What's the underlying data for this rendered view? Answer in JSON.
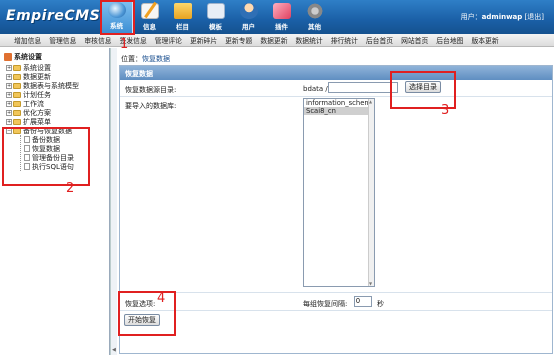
{
  "header": {
    "logo": "EmpireCMS",
    "nav": [
      {
        "label": "系统",
        "icon": "globe-icon",
        "active": true
      },
      {
        "label": "信息",
        "icon": "pencil-icon",
        "active": false
      },
      {
        "label": "栏目",
        "icon": "folder-icon",
        "active": false
      },
      {
        "label": "模板",
        "icon": "template-icon",
        "active": false
      },
      {
        "label": "用户",
        "icon": "user-icon",
        "active": false
      },
      {
        "label": "插件",
        "icon": "plugin-icon",
        "active": false
      },
      {
        "label": "其他",
        "icon": "gear-icon",
        "active": false
      }
    ],
    "user_prefix": "用户：",
    "username": "adminwap",
    "logout": "[退出]"
  },
  "menubar": [
    "增加信息",
    "管理信息",
    "审核信息",
    "签发信息",
    "管理评论",
    "更新碎片",
    "更新专题",
    "数据更新",
    "数据统计",
    "排行统计",
    "后台首页",
    "网站首页",
    "后台地图",
    "版本更新"
  ],
  "sidebar": {
    "root": "系统设置",
    "items": [
      {
        "label": "系统设置"
      },
      {
        "label": "数据更新"
      },
      {
        "label": "数据表与系统模型"
      },
      {
        "label": "计划任务"
      },
      {
        "label": "工作流"
      },
      {
        "label": "优化方案"
      },
      {
        "label": "扩展菜单"
      }
    ],
    "open_item": "备份与恢复数据",
    "sub_items": [
      {
        "label": "备份数据"
      },
      {
        "label": "恢复数据"
      },
      {
        "label": "管理备份目录"
      },
      {
        "label": "执行SQL语句"
      }
    ]
  },
  "main": {
    "location_prefix": "位置：",
    "location_link": "恢复数据",
    "panel_title": "恢复数据",
    "path_label": "恢复数据源目录:",
    "path_prefix": "bdata /",
    "path_value": "",
    "choose_dir_button": "选择目录",
    "db_label": "要导入的数据库:",
    "db_options": [
      "information_schema",
      "Scai8_cn"
    ],
    "db_selected": "Scai8_cn",
    "restore_options_label": "恢复选项:",
    "interval_label": "每组恢复间隔:",
    "interval_value": "0",
    "interval_unit": "秒",
    "start_button": "开始恢复"
  },
  "annotations": {
    "color": "#e02020",
    "numbers": [
      "1",
      "2",
      "3",
      "4"
    ]
  }
}
